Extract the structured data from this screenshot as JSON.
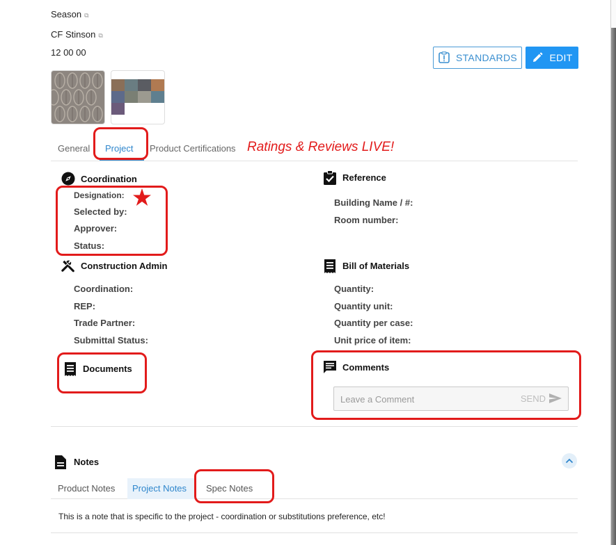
{
  "meta": {
    "season_label": "Season",
    "manufacturer": "CF Stinson",
    "spec_code": "12 00 00"
  },
  "actions": {
    "standards_label": "STANDARDS",
    "edit_label": "EDIT"
  },
  "tabs": [
    {
      "label": "General"
    },
    {
      "label": "Project",
      "active": true
    },
    {
      "label": "Product Certifications"
    }
  ],
  "annotation": {
    "ratings_text": "Ratings & Reviews LIVE!"
  },
  "coordination": {
    "title": "Coordination",
    "fields": [
      "Designation:",
      "Selected by:",
      "Approver:",
      "Status:"
    ]
  },
  "reference": {
    "title": "Reference",
    "fields": [
      "Building Name / #:",
      "Room number:"
    ]
  },
  "construction_admin": {
    "title": "Construction Admin",
    "fields": [
      "Coordination:",
      "REP:",
      "Trade Partner:",
      "Submittal Status:"
    ]
  },
  "bill_of_materials": {
    "title": "Bill of Materials",
    "fields": [
      "Quantity:",
      "Quantity unit:",
      "Quantity per case:",
      "Unit price of item:"
    ]
  },
  "documents": {
    "title": "Documents"
  },
  "comments": {
    "title": "Comments",
    "placeholder": "Leave a Comment",
    "send_label": "SEND"
  },
  "notes": {
    "title": "Notes",
    "tabs": [
      {
        "label": "Product Notes"
      },
      {
        "label": "Project Notes",
        "active": true
      },
      {
        "label": "Spec Notes"
      }
    ],
    "content": "This is a note that is specific to the project - coordination or substitutions preference, etc!"
  },
  "colors": {
    "accent": "#2196f3",
    "annotation_red": "#e21b1b"
  },
  "icons": {
    "ext_link": "external-link-icon",
    "standards": "alert-box-icon",
    "edit": "pencil-icon",
    "coordination": "compass-icon",
    "reference": "clipboard-check-icon",
    "construction_admin": "tools-icon",
    "bill_of_materials": "receipt-icon",
    "documents": "document-icon",
    "comments": "comment-icon",
    "send": "send-icon",
    "notes": "file-icon",
    "collapse": "chevron-up-icon"
  }
}
